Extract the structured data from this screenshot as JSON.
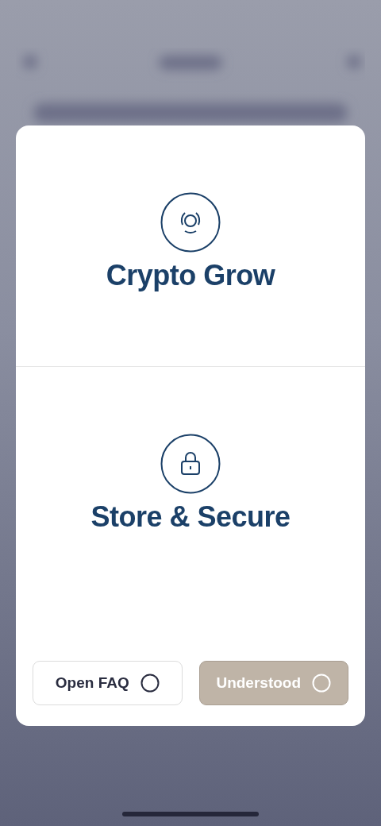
{
  "sections": [
    {
      "kind": "orbit",
      "title": "Crypto Grow"
    },
    {
      "kind": "lock",
      "title": "Store & Secure"
    }
  ],
  "buttons": [
    {
      "label": "Open FAQ",
      "disabled": false
    },
    {
      "label": "Understood",
      "disabled": true
    }
  ]
}
